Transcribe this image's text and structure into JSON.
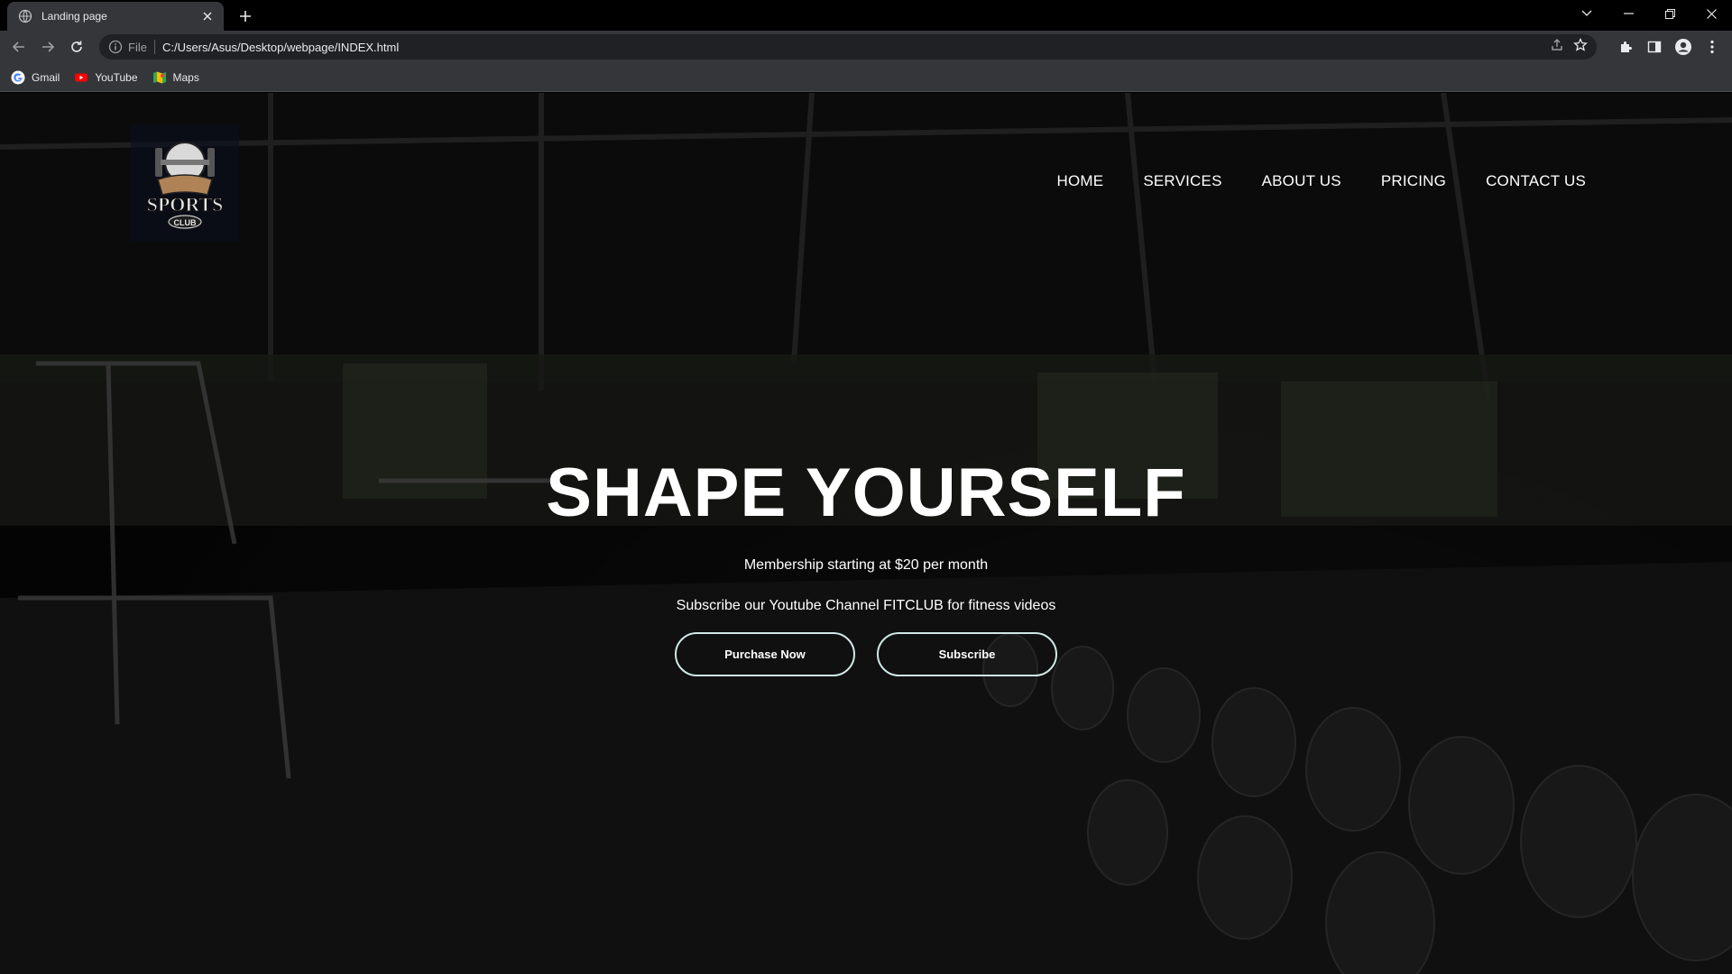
{
  "browser": {
    "tab_title": "Landing page",
    "address_scheme": "File",
    "address_url": "C:/Users/Asus/Desktop/webpage/INDEX.html",
    "bookmarks": [
      {
        "label": "Gmail",
        "icon": "google-icon"
      },
      {
        "label": "YouTube",
        "icon": "youtube-icon"
      },
      {
        "label": "Maps",
        "icon": "maps-icon"
      }
    ]
  },
  "site": {
    "logo_text": "SPORTS",
    "logo_subtext": "CLUB",
    "nav": [
      "HOME",
      "SERVICES",
      "ABOUT US",
      "PRICING",
      "CONTACT US"
    ],
    "hero": {
      "title": "SHAPE YOURSELF",
      "line1": "Membership starting at $20 per month",
      "line2": "Subscribe our Youtube Channel FITCLUB for fitness videos",
      "primary_button": "Purchase Now",
      "secondary_button": "Subscribe"
    }
  },
  "colors": {
    "chrome_dark": "#000000",
    "chrome_toolbar": "#35363a",
    "button_border": "#cfe9e6"
  }
}
